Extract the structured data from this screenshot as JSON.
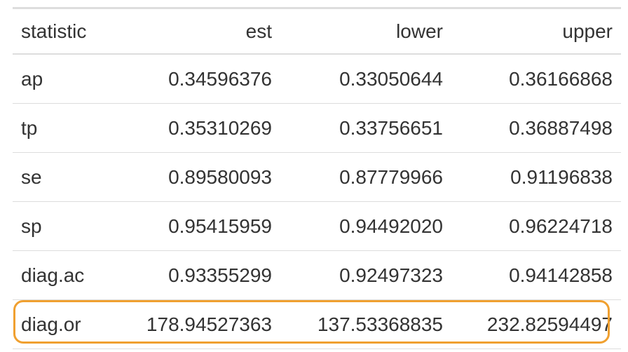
{
  "table": {
    "columns": [
      "statistic",
      "est",
      "lower",
      "upper"
    ],
    "rows": [
      {
        "statistic": "ap",
        "est": "0.34596376",
        "lower": "0.33050644",
        "upper": "0.36166868"
      },
      {
        "statistic": "tp",
        "est": "0.35310269",
        "lower": "0.33756651",
        "upper": "0.36887498"
      },
      {
        "statistic": "se",
        "est": "0.89580093",
        "lower": "0.87779966",
        "upper": "0.91196838"
      },
      {
        "statistic": "sp",
        "est": "0.95415959",
        "lower": "0.94492020",
        "upper": "0.96224718"
      },
      {
        "statistic": "diag.ac",
        "est": "0.93355299",
        "lower": "0.92497323",
        "upper": "0.94142858"
      },
      {
        "statistic": "diag.or",
        "est": "178.94527363",
        "lower": "137.53368835",
        "upper": "232.82594497"
      }
    ]
  },
  "colors": {
    "text": "#333333",
    "border": "#dddddd",
    "highlight": "#f0a030"
  }
}
